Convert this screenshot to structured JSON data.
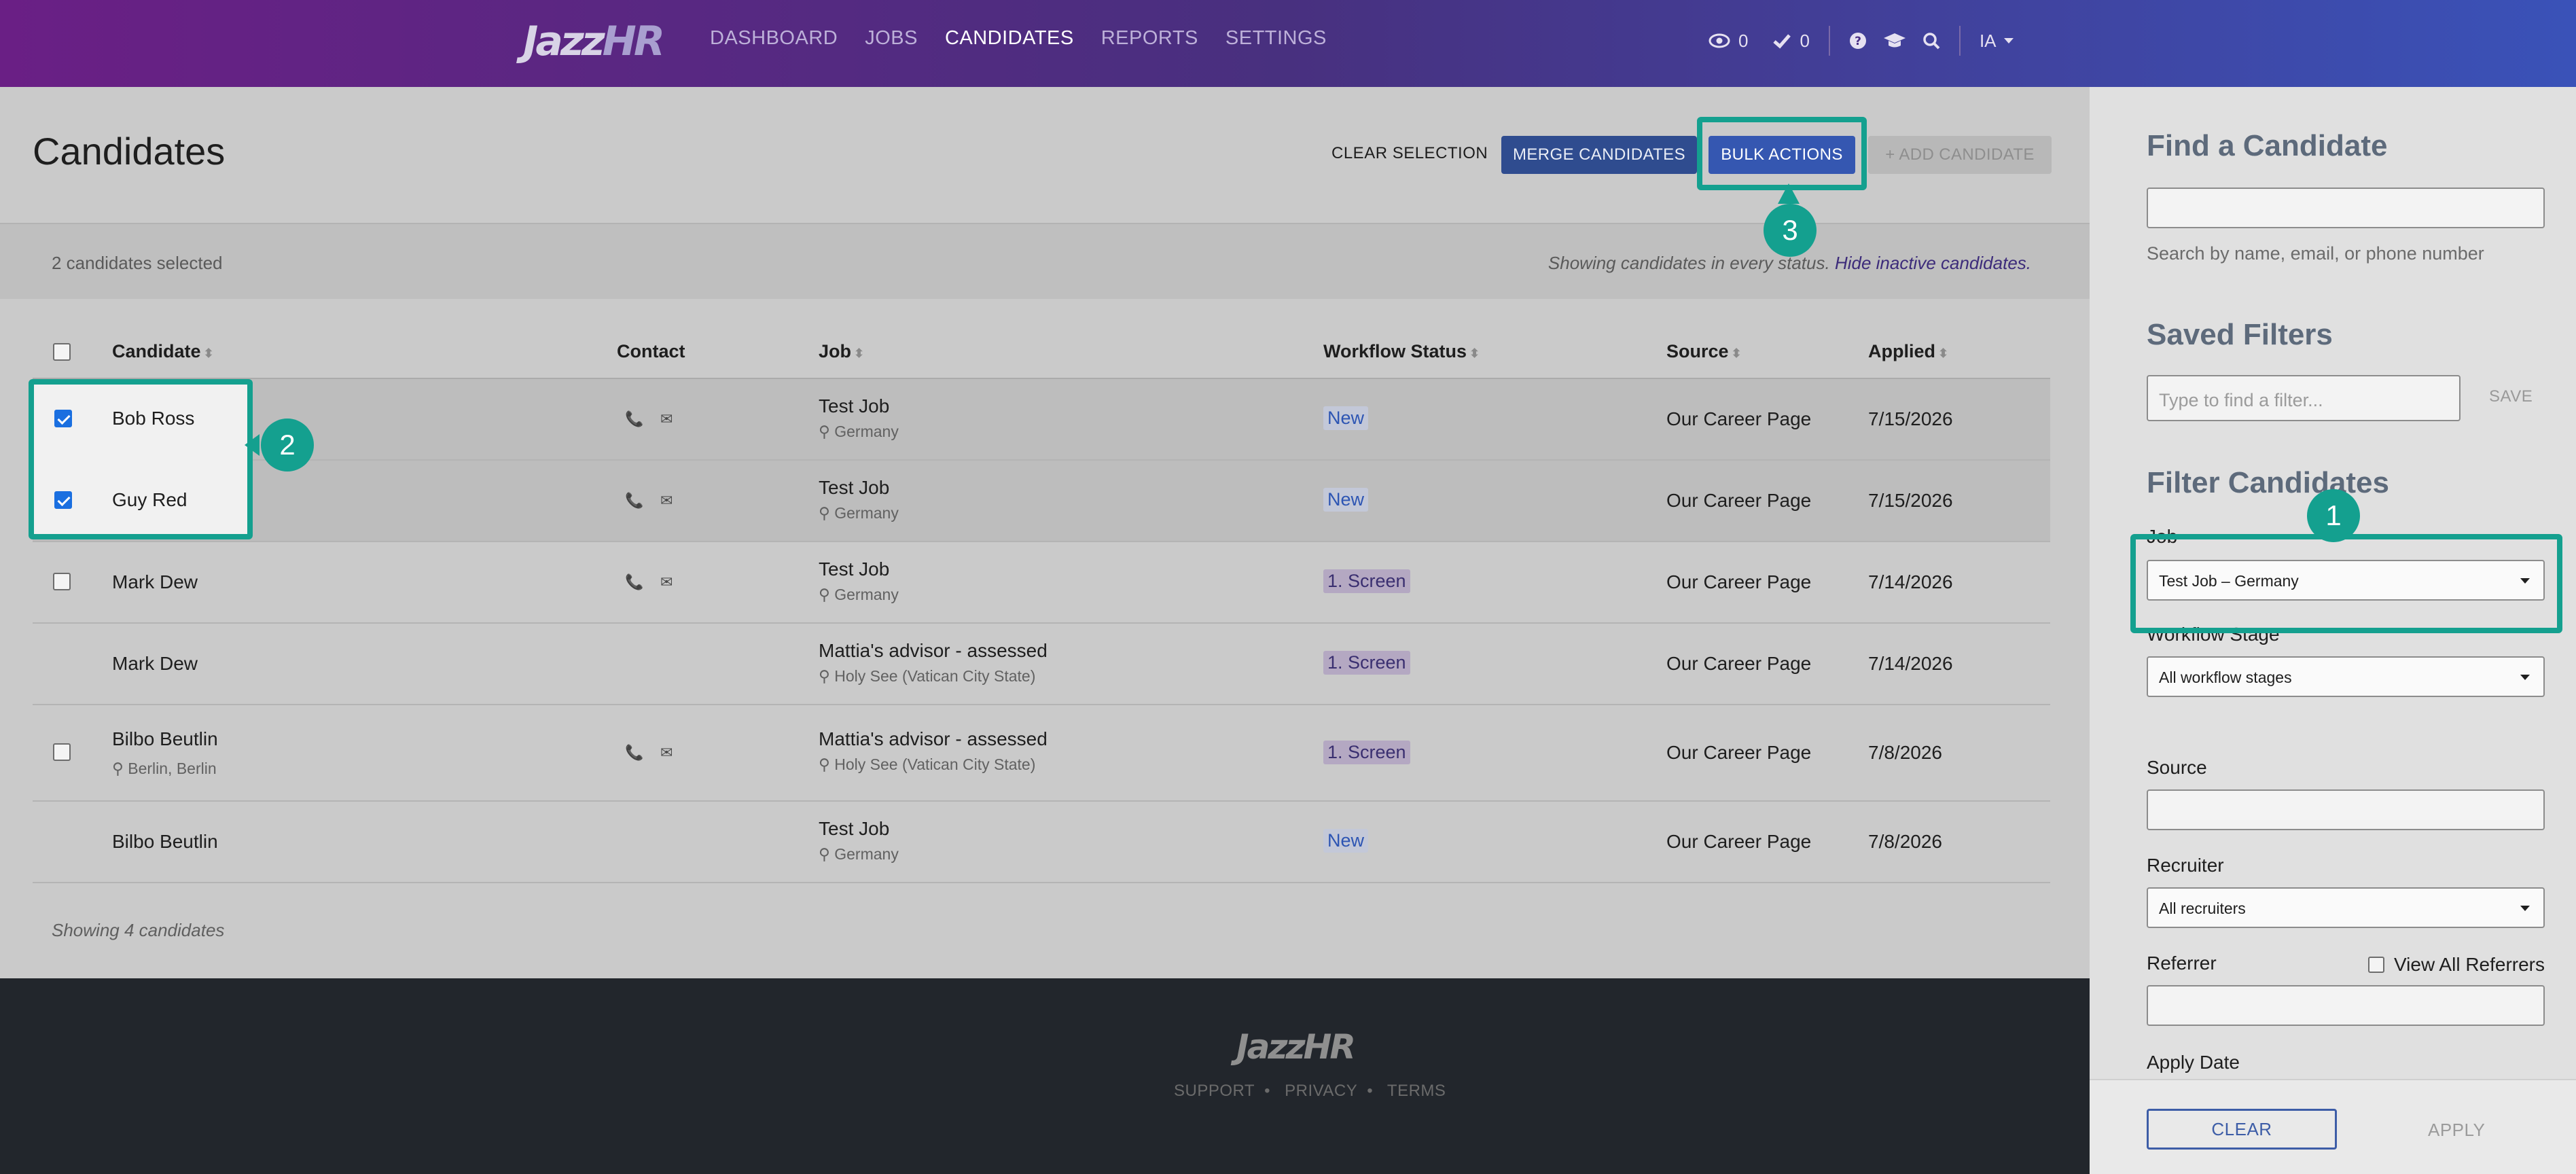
{
  "nav": {
    "logo_main": "Jazz",
    "logo_accent": "HR",
    "links": [
      "DASHBOARD",
      "JOBS",
      "CANDIDATES",
      "REPORTS",
      "SETTINGS"
    ],
    "active": "CANDIDATES",
    "views_count": "0",
    "checks_count": "0",
    "user_initials": "IA"
  },
  "header": {
    "title": "Candidates",
    "clear_selection": "CLEAR SELECTION",
    "merge": "MERGE CANDIDATES",
    "bulk": "BULK ACTIONS",
    "add": "+ ADD CANDIDATE"
  },
  "selection": {
    "count_text": "2 candidates selected",
    "showing_text": "Showing candidates in every status.",
    "hide_link": "Hide inactive candidates."
  },
  "table": {
    "columns": [
      "Candidate",
      "Contact",
      "Job",
      "Workflow Status",
      "Source",
      "Applied"
    ],
    "rows": [
      {
        "name": "Bob Ross",
        "location": "",
        "job": "Test Job",
        "job_loc": "Germany",
        "status": "New",
        "source": "Our Career Page",
        "applied": "7/15/2026",
        "checked": true,
        "has_checkbox": true,
        "has_contact": true
      },
      {
        "name": "Guy Red",
        "location": "",
        "job": "Test Job",
        "job_loc": "Germany",
        "status": "New",
        "source": "Our Career Page",
        "applied": "7/15/2026",
        "checked": true,
        "has_checkbox": true,
        "has_contact": true
      },
      {
        "name": "Mark Dew",
        "location": "",
        "job": "Test Job",
        "job_loc": "Germany",
        "status": "1. Screen",
        "source": "Our Career Page",
        "applied": "7/14/2026",
        "checked": false,
        "has_checkbox": true,
        "has_contact": true
      },
      {
        "name": "Mark Dew",
        "location": "",
        "job": "Mattia's advisor - assessed",
        "job_loc": "Holy See (Vatican City State)",
        "status": "1. Screen",
        "source": "Our Career Page",
        "applied": "7/14/2026",
        "checked": false,
        "has_checkbox": false,
        "has_contact": false
      },
      {
        "name": "Bilbo Beutlin",
        "location": "Berlin, Berlin",
        "job": "Mattia's advisor - assessed",
        "job_loc": "Holy See (Vatican City State)",
        "status": "1. Screen",
        "source": "Our Career Page",
        "applied": "7/8/2026",
        "checked": false,
        "has_checkbox": true,
        "has_contact": true
      },
      {
        "name": "Bilbo Beutlin",
        "location": "",
        "job": "Test Job",
        "job_loc": "Germany",
        "status": "New",
        "source": "Our Career Page",
        "applied": "7/8/2026",
        "checked": false,
        "has_checkbox": false,
        "has_contact": false
      }
    ],
    "footnote": "Showing 4 candidates"
  },
  "footer": {
    "logo_main": "Jazz",
    "logo_accent": "HR",
    "support": "SUPPORT",
    "privacy": "PRIVACY",
    "terms": "TERMS"
  },
  "sidebar": {
    "find_title": "Find a Candidate",
    "find_help": "Search by name, email, or phone number",
    "saved_title": "Saved Filters",
    "saved_placeholder": "Type to find a filter...",
    "save_label": "SAVE",
    "filter_title": "Filter Candidates",
    "job_label": "Job",
    "job_value": "Test Job – Germany",
    "stage_label": "Workflow Stage",
    "stage_value": "All workflow stages",
    "source_label": "Source",
    "recruiter_label": "Recruiter",
    "recruiter_value": "All recruiters",
    "referrer_label": "Referrer",
    "view_all_referrers": "View All Referrers",
    "apply_date_label": "Apply Date",
    "clear": "CLEAR",
    "apply": "APPLY"
  },
  "annotations": {
    "m1": "1",
    "m2": "2",
    "m3": "3"
  },
  "colors": {
    "accent": "#14a08f",
    "primary": "#3557b1",
    "nav_start": "#6a1f85",
    "nav_end": "#3a52b8"
  }
}
